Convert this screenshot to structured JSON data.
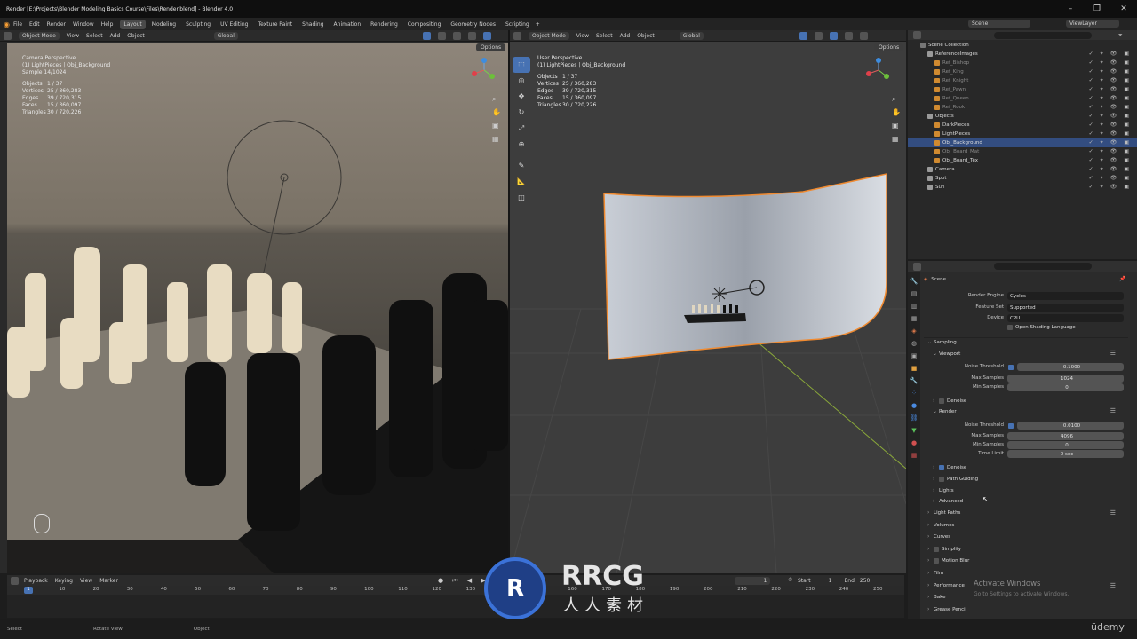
{
  "window": {
    "title": "Render [E:\\Projects\\Blender Modeling Basics Course\\Files\\Render.blend] - Blender 4.0",
    "min": "–",
    "max": "❐",
    "close": "✕"
  },
  "menu": {
    "items": [
      "File",
      "Edit",
      "Render",
      "Window",
      "Help"
    ],
    "workspaces": [
      "Layout",
      "Modeling",
      "Sculpting",
      "UV Editing",
      "Texture Paint",
      "Shading",
      "Animation",
      "Rendering",
      "Compositing",
      "Geometry Nodes",
      "Scripting"
    ],
    "add_tab": "+",
    "scene": "Scene",
    "view_layer": "ViewLayer"
  },
  "viewport_left": {
    "mode": "Object Mode",
    "menus": [
      "View",
      "Select",
      "Add",
      "Object"
    ],
    "orientation": "Global",
    "options": "Options",
    "info": [
      "Camera Perspective",
      "(1) LightPieces | Obj_Background",
      "Sample 14/1024"
    ],
    "stats": [
      [
        "Objects",
        "1 / 37"
      ],
      [
        "Vertices",
        "25 / 360,283"
      ],
      [
        "Edges",
        "39 / 720,315"
      ],
      [
        "Faces",
        "15 / 360,097"
      ],
      [
        "Triangles",
        "30 / 720,226"
      ]
    ]
  },
  "viewport_right": {
    "mode": "Object Mode",
    "menus": [
      "View",
      "Select",
      "Add",
      "Object"
    ],
    "orientation": "Global",
    "options": "Options",
    "info": [
      "User Perspective",
      "(1) LightPieces | Obj_Background"
    ],
    "stats": [
      [
        "Objects",
        "1 / 37"
      ],
      [
        "Vertices",
        "25 / 360,283"
      ],
      [
        "Edges",
        "39 / 720,315"
      ],
      [
        "Faces",
        "15 / 360,097"
      ],
      [
        "Triangles",
        "30 / 720,226"
      ]
    ]
  },
  "outliner": {
    "root": "Scene Collection",
    "rows": [
      {
        "name": "ReferenceImages",
        "level": 1,
        "dim": false,
        "sel": false
      },
      {
        "name": "Ref_Bishop",
        "level": 2,
        "dim": true,
        "sel": false
      },
      {
        "name": "Ref_King",
        "level": 2,
        "dim": true,
        "sel": false
      },
      {
        "name": "Ref_Knight",
        "level": 2,
        "dim": true,
        "sel": false
      },
      {
        "name": "Ref_Pawn",
        "level": 2,
        "dim": true,
        "sel": false
      },
      {
        "name": "Ref_Queen",
        "level": 2,
        "dim": true,
        "sel": false
      },
      {
        "name": "Ref_Rook",
        "level": 2,
        "dim": true,
        "sel": false
      },
      {
        "name": "Objects",
        "level": 1,
        "dim": false,
        "sel": false
      },
      {
        "name": "DarkPieces",
        "level": 2,
        "dim": false,
        "sel": false
      },
      {
        "name": "LightPieces",
        "level": 2,
        "dim": false,
        "sel": false
      },
      {
        "name": "Obj_Background",
        "level": 2,
        "dim": false,
        "sel": true
      },
      {
        "name": "Obj_Board_Mat",
        "level": 2,
        "dim": true,
        "sel": false
      },
      {
        "name": "Obj_Board_Tex",
        "level": 2,
        "dim": false,
        "sel": false
      },
      {
        "name": "Camera",
        "level": 1,
        "dim": false,
        "sel": false
      },
      {
        "name": "Spot",
        "level": 1,
        "dim": false,
        "sel": false
      },
      {
        "name": "Sun",
        "level": 1,
        "dim": false,
        "sel": false
      }
    ]
  },
  "properties": {
    "context": "Scene",
    "render_engine_label": "Render Engine",
    "render_engine": "Cycles",
    "feature_set_label": "Feature Set",
    "feature_set": "Supported",
    "device_label": "Device",
    "device": "CPU",
    "osl": "Open Shading Language",
    "sampling": "Sampling",
    "viewport": "Viewport",
    "noise_threshold_label": "Noise Threshold",
    "vp_noise": "0.1000",
    "max_samples_label": "Max Samples",
    "vp_max": "1024",
    "min_samples_label": "Min Samples",
    "vp_min": "0",
    "denoise": "Denoise",
    "render": "Render",
    "r_noise": "0.0100",
    "r_max": "4096",
    "r_min": "0",
    "time_limit_label": "Time Limit",
    "r_time": "0 sec",
    "r_denoise": "Denoise",
    "path_guiding": "Path Guiding",
    "lights": "Lights",
    "advanced": "Advanced",
    "panels": [
      "Light Paths",
      "Volumes",
      "Curves",
      "Simplify",
      "Motion Blur",
      "Film",
      "Performance",
      "Bake",
      "Grease Pencil"
    ],
    "activate": "Activate Windows",
    "activate_sub": "Go to Settings to activate Windows."
  },
  "timeline": {
    "menus": [
      "Playback",
      "Keying",
      "View",
      "Marker"
    ],
    "current": "1",
    "start_label": "Start",
    "start": "1",
    "end_label": "End",
    "end": "250",
    "frames": [
      "1",
      "10",
      "20",
      "30",
      "40",
      "50",
      "60",
      "70",
      "80",
      "90",
      "100",
      "110",
      "120",
      "130",
      "140",
      "150",
      "160",
      "170",
      "180",
      "190",
      "200",
      "210",
      "220",
      "230",
      "240",
      "250"
    ]
  },
  "status": {
    "select": "Select",
    "rotate": "Rotate View",
    "object": "Object"
  },
  "watermark": {
    "logo": "RRCG",
    "sub": "人人素材",
    "udemy": "ūdemy"
  }
}
